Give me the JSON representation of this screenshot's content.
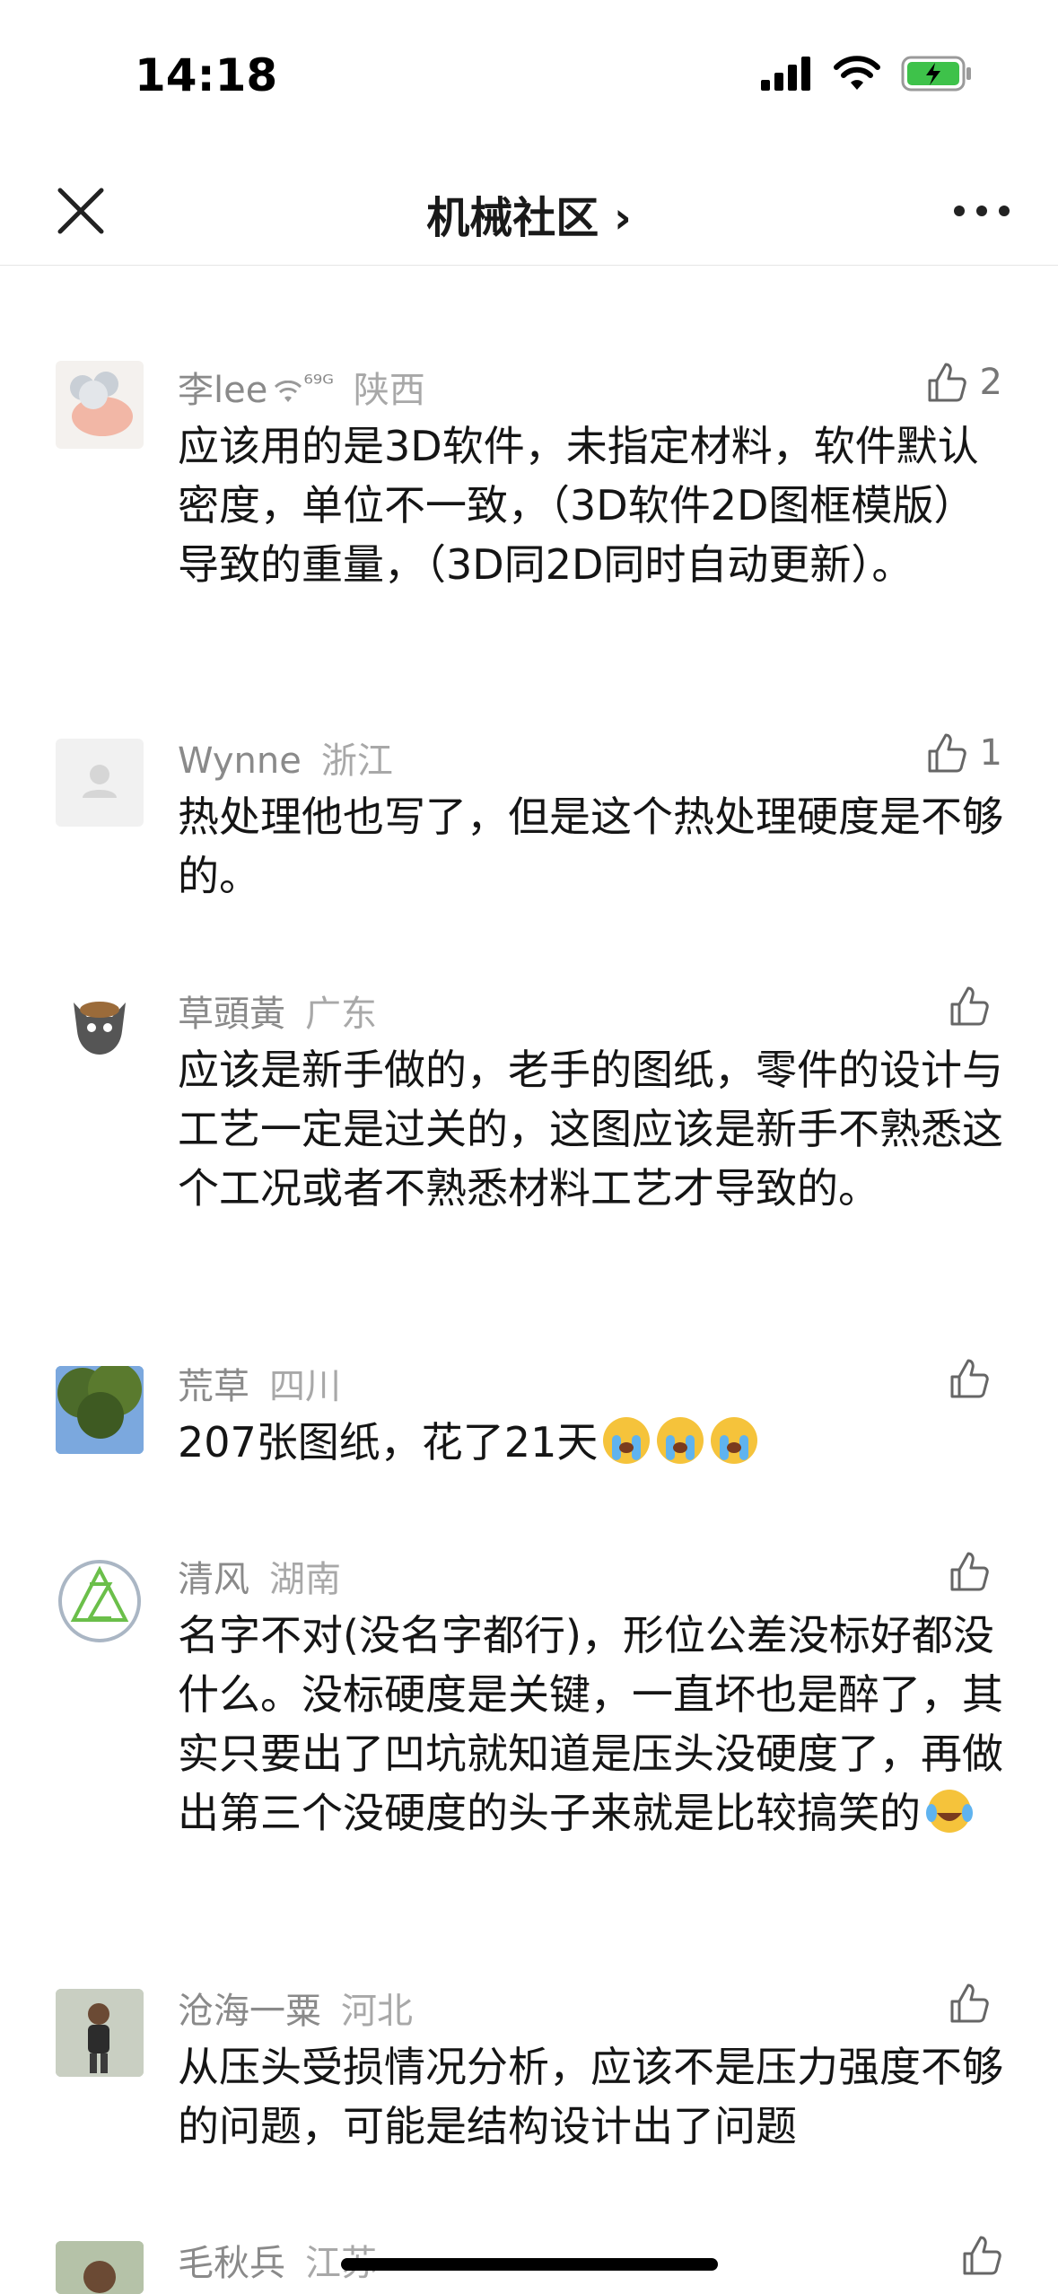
{
  "status_bar": {
    "time": "14:18"
  },
  "nav": {
    "title": "机械社区 ›"
  },
  "comments": [
    {
      "name": "李lee",
      "name_suffix": "⁶⁹ᴳ",
      "location": "陕西",
      "likes": "2",
      "text": "应该用的是3D软件，未指定材料，软件默认密度，单位不一致，（3D软件2D图框模版）导致的重量，（3D同2D同时自动更新）。"
    },
    {
      "name": "Wynne",
      "location": "浙江",
      "likes": "1",
      "text": "热处理他也写了，但是这个热处理硬度是不够的。"
    },
    {
      "name": "草頭黃",
      "location": "广东",
      "likes": "",
      "text": "应该是新手做的，老手的图纸，零件的设计与工艺一定是过关的，这图应该是新手不熟悉这个工况或者不熟悉材料工艺才导致的。"
    },
    {
      "name": "荒草",
      "location": "四川",
      "likes": "",
      "text": "207张图纸，花了21天"
    },
    {
      "name": "清风",
      "location": "湖南",
      "likes": "",
      "text": "名字不对(没名字都行)，形位公差没标好都没什么。没标硬度是关键，一直坏也是醉了，其实只要出了凹坑就知道是压头没硬度了，再做出第三个没硬度的头子来就是比较搞笑的"
    },
    {
      "name": "沧海一粟",
      "location": "河北",
      "likes": "",
      "text": "从压头受损情况分析，应该不是压力强度不够的问题，可能是结构设计出了问题"
    },
    {
      "name": "毛秋兵",
      "location": "江苏",
      "likes": "",
      "text": ""
    }
  ],
  "icons": {
    "close": "close-icon",
    "more": "more-icon",
    "like": "thumbs-up-icon",
    "crying": "loudly-crying-face-emoji",
    "laughing": "tears-of-joy-emoji"
  },
  "colors": {
    "name_gray": "#8a8a8a",
    "text": "#151515",
    "divider": "#e6e6e6"
  }
}
